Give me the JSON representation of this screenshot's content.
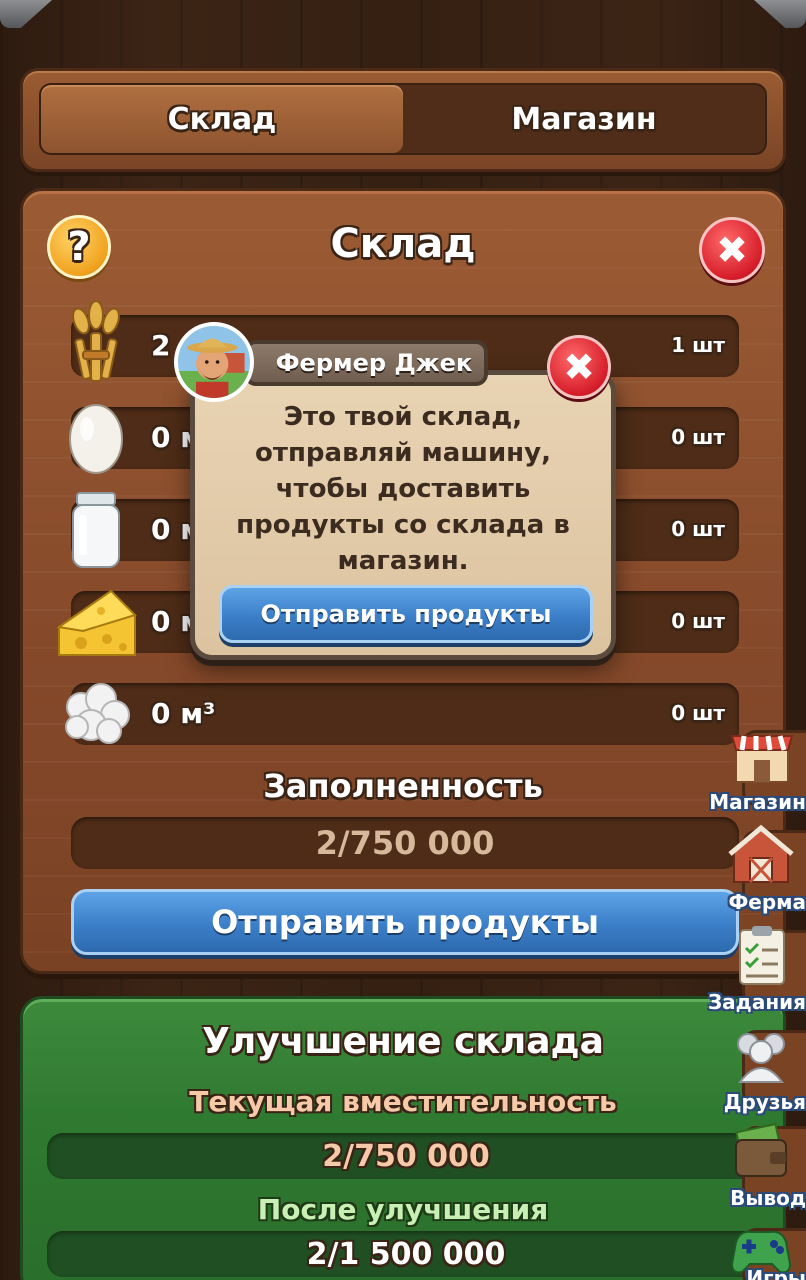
{
  "tabs": [
    {
      "label": "Склад",
      "active": true
    },
    {
      "label": "Магазин",
      "active": false
    }
  ],
  "panel": {
    "title": "Склад",
    "help_icon": "question-icon",
    "close_icon": "close-icon",
    "rows": [
      {
        "icon": "wheat-icon",
        "amount": "2",
        "count": "1 шт"
      },
      {
        "icon": "egg-icon",
        "amount": "0 м",
        "count": "0 шт"
      },
      {
        "icon": "milk-jar-icon",
        "amount": "0 м",
        "count": "0 шт"
      },
      {
        "icon": "cheese-icon",
        "amount": "0 м",
        "count": "0 шт"
      },
      {
        "icon": "wool-icon",
        "amount": "0 м³",
        "count": "0 шт"
      }
    ],
    "fill_label": "Заполненность",
    "fill_value": "2/750 000",
    "send_button": "Отправить продукты"
  },
  "upgrade": {
    "title": "Улучшение склада",
    "current_label": "Текущая вместительность",
    "current_value": "2/750 000",
    "after_label": "После улучшения",
    "after_value": "2/1 500 000"
  },
  "side_nav": [
    {
      "label": "Магазин",
      "icon": "shop-icon"
    },
    {
      "label": "Ферма",
      "icon": "barn-icon"
    },
    {
      "label": "Задания",
      "icon": "tasks-icon"
    },
    {
      "label": "Друзья",
      "icon": "friends-icon"
    },
    {
      "label": "Вывод",
      "icon": "wallet-icon"
    },
    {
      "label": "Игры",
      "icon": "gamepad-icon"
    }
  ],
  "popup": {
    "speaker": "Фермер Джек",
    "text": "Это твой склад, отправляй машину, чтобы доставить продукты со склада в магазин.",
    "button": "Отправить продукты"
  },
  "colors": {
    "wood": "#8a4e2c",
    "wood_dark": "#4e2c17",
    "blue_button": "#3b7fc9",
    "green_panel": "#2f7a31",
    "close_red": "#d61d2a",
    "help_orange": "#f0a21e"
  }
}
